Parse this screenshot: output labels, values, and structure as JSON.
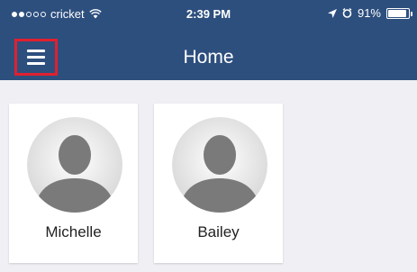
{
  "status_bar": {
    "carrier": "cricket",
    "signal_bars_filled": 2,
    "signal_bars_total": 5,
    "time": "2:39 PM",
    "battery_percent": "91%",
    "battery_level": 0.91
  },
  "header": {
    "title": "Home",
    "menu_icon": "hamburger-menu-icon"
  },
  "profiles": [
    {
      "name": "Michelle",
      "avatar_icon": "person-placeholder-icon"
    },
    {
      "name": "Bailey",
      "avatar_icon": "person-placeholder-icon"
    }
  ],
  "colors": {
    "header_bg": "#2d4f7e",
    "page_bg": "#efeff4",
    "menu_highlight": "#e0202f"
  }
}
